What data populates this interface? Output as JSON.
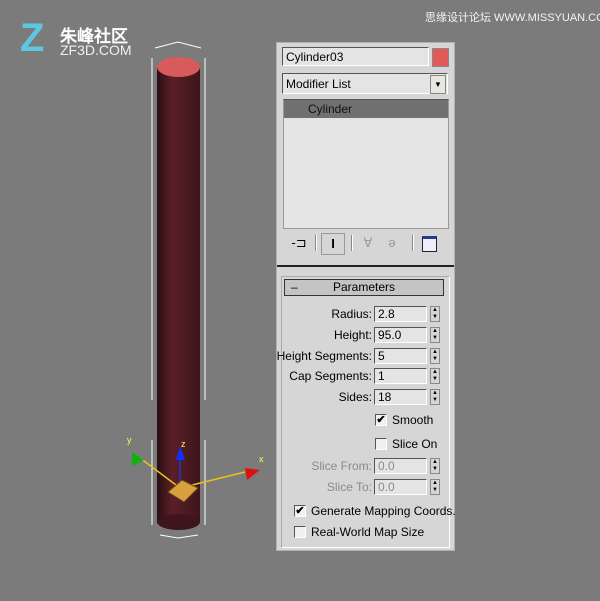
{
  "watermarks": {
    "left_cn": "朱峰社区",
    "left_en": "ZF3D.COM",
    "right": "思缘设计论坛 WWW.MISSYUAN.COM"
  },
  "object": {
    "name": "Cylinder03",
    "color": "#e05a5a"
  },
  "modifier_list": {
    "label": "Modifier List"
  },
  "stack": {
    "items": [
      {
        "label": "Cylinder",
        "selected": true
      }
    ]
  },
  "toolbar": {
    "icons": [
      "pin-stack-icon",
      "show-end-result-icon",
      "make-unique-icon",
      "remove-modifier-icon",
      "configure-modifier-sets-icon"
    ]
  },
  "rollout": {
    "toggle": "–",
    "title": "Parameters"
  },
  "params": [
    {
      "label": "Radius:",
      "value": "2.8",
      "enabled": true
    },
    {
      "label": "Height:",
      "value": "95.0",
      "enabled": true
    },
    {
      "label": "Height Segments:",
      "value": "5",
      "enabled": true
    },
    {
      "label": "Cap Segments:",
      "value": "1",
      "enabled": true
    },
    {
      "label": "Sides:",
      "value": "18",
      "enabled": true
    }
  ],
  "smooth": {
    "label": "Smooth",
    "checked": true
  },
  "slice_on": {
    "label": "Slice On",
    "checked": false
  },
  "slice": [
    {
      "label": "Slice From:",
      "value": "0.0",
      "enabled": false
    },
    {
      "label": "Slice To:",
      "value": "0.0",
      "enabled": false
    }
  ],
  "gen_mapping": {
    "label": "Generate Mapping Coords.",
    "checked": true
  },
  "real_world": {
    "label": "Real-World Map Size",
    "checked": false
  },
  "gizmo": {
    "x": "x",
    "y": "y",
    "z": "z"
  },
  "check_glyph": "✔"
}
